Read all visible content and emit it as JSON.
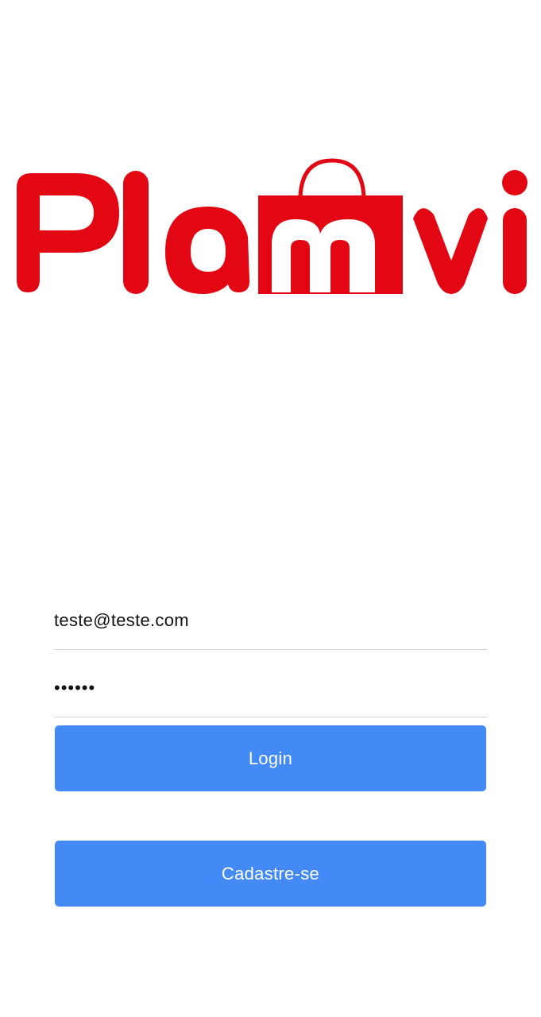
{
  "brand": {
    "logo_text": "Plamvi",
    "logo_color": "#E30613",
    "icon": "shopping-bag-icon"
  },
  "form": {
    "email_value": "teste@teste.com",
    "password_value": "123456"
  },
  "buttons": {
    "login_label": "Login",
    "signup_label": "Cadastre-se",
    "color": "#448AF7"
  }
}
